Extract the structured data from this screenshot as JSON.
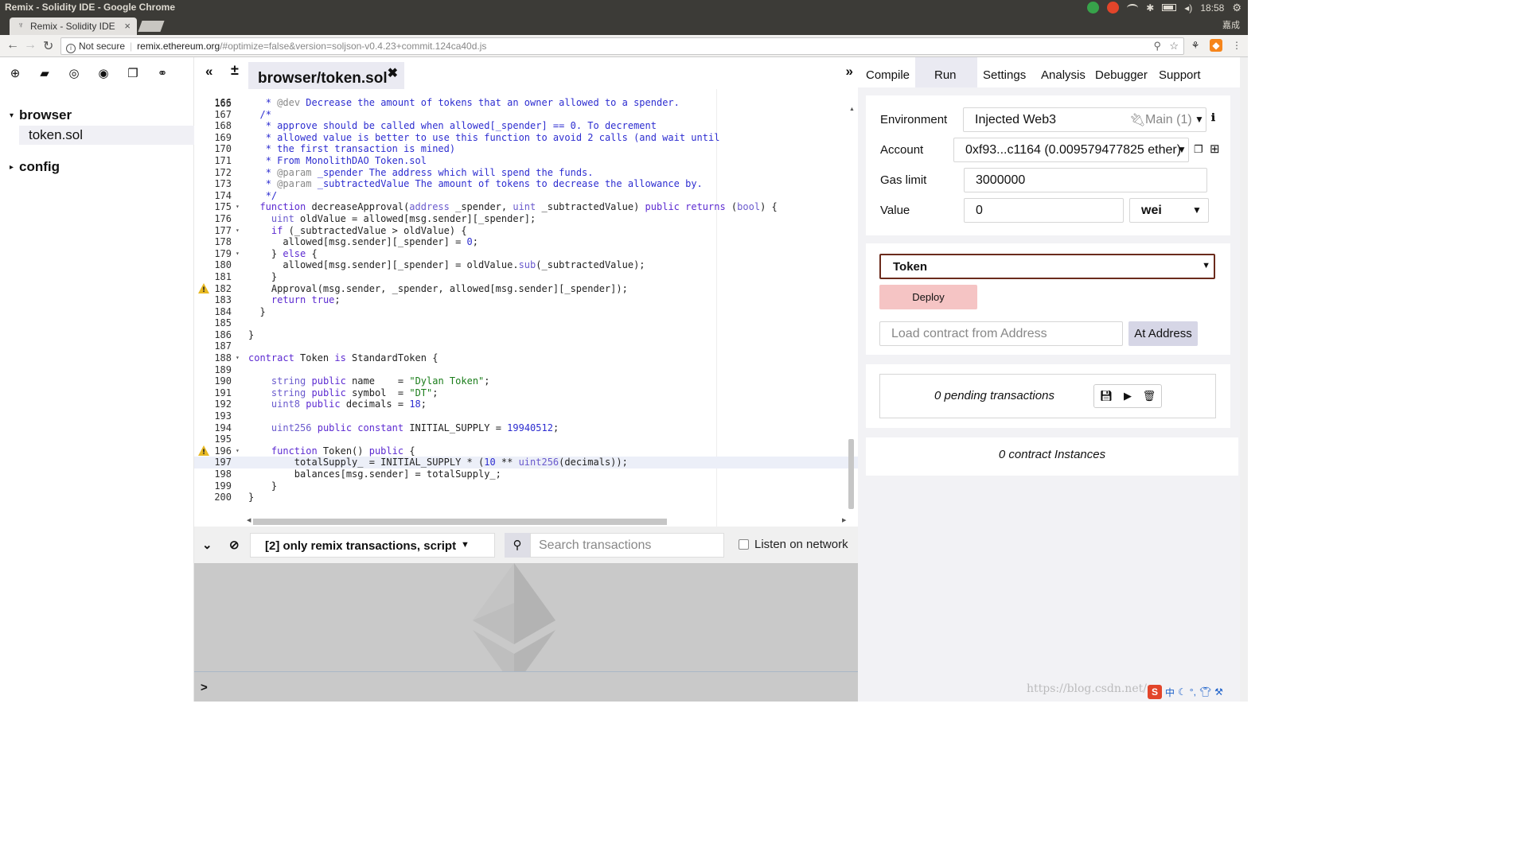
{
  "os": {
    "window_title": "Remix - Solidity IDE - Google Chrome",
    "clock": "18:58",
    "user": "嘉成"
  },
  "browser": {
    "tab_title": "Remix - Solidity IDE",
    "tab_close": "×",
    "security_label": "Not secure",
    "url_host": "remix.ethereum.org",
    "url_path": "/#optimize=false&version=soljson-v0.4.23+commit.124ca40d.js"
  },
  "files": {
    "tree": [
      {
        "label": "browser",
        "expanded": true,
        "caret": "▾"
      },
      {
        "label": "token.sol",
        "selected": true
      },
      {
        "label": "config",
        "expanded": false,
        "caret": "▸"
      }
    ]
  },
  "editor": {
    "collapse": "«",
    "add_file": "±",
    "tab_label": "browser/token.sol",
    "tab_close": "✖",
    "expand": "»",
    "first_partial_line": "165",
    "lines": [
      {
        "n": "166",
        "fold": "",
        "warn": false,
        "html": "   <span class='tok-cm'>* <span class='tok-tag'>@dev</span> Decrease the amount of tokens that an owner allowed to a spender.</span>"
      },
      {
        "n": "167",
        "fold": "",
        "warn": false,
        "html": "   <span class='tok-cm'>*</span>"
      },
      {
        "n": "168",
        "fold": "",
        "warn": false,
        "html": "   <span class='tok-cm'>* approve should be called when allowed[_spender] == 0. To decrement</span>"
      },
      {
        "n": "169",
        "fold": "",
        "warn": false,
        "html": "   <span class='tok-cm'>* allowed value is better to use this function to avoid 2 calls (and wait until</span>"
      },
      {
        "n": "170",
        "fold": "",
        "warn": false,
        "html": "   <span class='tok-cm'>* the first transaction is mined)</span>"
      },
      {
        "n": "171",
        "fold": "",
        "warn": false,
        "html": "   <span class='tok-cm'>* From MonolithDAO Token.sol</span>"
      },
      {
        "n": "172",
        "fold": "",
        "warn": false,
        "html": "   <span class='tok-cm'>* <span class='tok-tag'>@param</span> _spender The address which will spend the funds.</span>"
      },
      {
        "n": "173",
        "fold": "",
        "warn": false,
        "html": "   <span class='tok-cm'>* <span class='tok-tag'>@param</span> _subtractedValue The amount of tokens to decrease the allowance by.</span>"
      },
      {
        "n": "174",
        "fold": "",
        "warn": false,
        "html": "   <span class='tok-cm'>*/</span>"
      },
      {
        "n": "175",
        "fold": "▾",
        "warn": false,
        "html": "  <span class='tok-kw'>function</span> decreaseApproval(<span class='tok-ty'>address</span> _spender, <span class='tok-ty'>uint</span> _subtractedValue) <span class='tok-kw'>public returns</span> (<span class='tok-ty'>bool</span>) {"
      },
      {
        "n": "176",
        "fold": "",
        "warn": false,
        "html": "    <span class='tok-ty'>uint</span> oldValue = allowed[msg.sender][_spender];"
      },
      {
        "n": "177",
        "fold": "▾",
        "warn": false,
        "html": "    <span class='tok-kw'>if</span> (_subtractedValue &gt; oldValue) {"
      },
      {
        "n": "178",
        "fold": "",
        "warn": false,
        "html": "      allowed[msg.sender][_spender] = <span class='tok-num'>0</span>;"
      },
      {
        "n": "179",
        "fold": "▾",
        "warn": false,
        "html": "    } <span class='tok-kw'>else</span> {"
      },
      {
        "n": "180",
        "fold": "",
        "warn": false,
        "html": "      allowed[msg.sender][_spender] = oldValue.<span class='tok-ty'>sub</span>(_subtractedValue);"
      },
      {
        "n": "181",
        "fold": "",
        "warn": false,
        "html": "    }"
      },
      {
        "n": "182",
        "fold": "",
        "warn": true,
        "html": "    Approval(msg.sender, _spender, allowed[msg.sender][_spender]);"
      },
      {
        "n": "183",
        "fold": "",
        "warn": false,
        "html": "    <span class='tok-kw'>return</span> <span class='tok-kw'>true</span>;"
      },
      {
        "n": "184",
        "fold": "",
        "warn": false,
        "html": "  }"
      },
      {
        "n": "185",
        "fold": "",
        "warn": false,
        "html": ""
      },
      {
        "n": "186",
        "fold": "",
        "warn": false,
        "html": "}"
      },
      {
        "n": "187",
        "fold": "",
        "warn": false,
        "html": ""
      },
      {
        "n": "188",
        "fold": "▾",
        "warn": false,
        "html": "<span class='tok-kw'>contract</span> Token <span class='tok-kw'>is</span> StandardToken {"
      },
      {
        "n": "189",
        "fold": "",
        "warn": false,
        "html": ""
      },
      {
        "n": "190",
        "fold": "",
        "warn": false,
        "html": "    <span class='tok-ty'>string</span> <span class='tok-kw'>public</span> name    = <span class='tok-str'>\"Dylan Token\"</span>;"
      },
      {
        "n": "191",
        "fold": "",
        "warn": false,
        "html": "    <span class='tok-ty'>string</span> <span class='tok-kw'>public</span> symbol  = <span class='tok-str'>\"DT\"</span>;"
      },
      {
        "n": "192",
        "fold": "",
        "warn": false,
        "html": "    <span class='tok-ty'>uint8</span> <span class='tok-kw'>public</span> decimals = <span class='tok-num'>18</span>;"
      },
      {
        "n": "193",
        "fold": "",
        "warn": false,
        "html": ""
      },
      {
        "n": "194",
        "fold": "",
        "warn": false,
        "html": "    <span class='tok-ty'>uint256</span> <span class='tok-kw'>public constant</span> INITIAL_SUPPLY = <span class='tok-num'>19940512</span>;"
      },
      {
        "n": "195",
        "fold": "",
        "warn": false,
        "html": ""
      },
      {
        "n": "196",
        "fold": "▾",
        "warn": true,
        "html": "    <span class='tok-kw'>function</span> Token() <span class='tok-kw'>public</span> {"
      },
      {
        "n": "197",
        "fold": "",
        "warn": false,
        "active": true,
        "html": "        totalSupply_ = INITIAL_SUPPLY * (<span class='tok-num'>10</span> ** <span class='tok-ty'>uint256</span>(decimals));"
      },
      {
        "n": "198",
        "fold": "",
        "warn": false,
        "html": "        balances[msg.sender] = totalSupply_;"
      },
      {
        "n": "199",
        "fold": "",
        "warn": false,
        "html": "    }"
      },
      {
        "n": "200",
        "fold": "",
        "warn": false,
        "html": "}"
      }
    ]
  },
  "terminal": {
    "filter_label": "[2] only remix transactions, script",
    "search_placeholder": "Search transactions",
    "listen_label": "Listen on network",
    "prompt": ">"
  },
  "run": {
    "tabs": [
      "Compile",
      "Run",
      "Settings",
      "Analysis",
      "Debugger",
      "Support"
    ],
    "active_tab": "Run",
    "environment_label": "Environment",
    "environment_value": "Injected Web3",
    "network": "Main (1)",
    "account_label": "Account",
    "account_value": "0xf93...c1164 (0.009579477825 ether)",
    "gas_label": "Gas limit",
    "gas_value": "3000000",
    "value_label": "Value",
    "value_value": "0",
    "unit": "wei",
    "contract": "Token",
    "deploy_label": "Deploy",
    "load_placeholder": "Load contract from Address",
    "at_address_label": "At Address",
    "pending_text": "0 pending transactions",
    "instances_text": "0 contract Instances"
  },
  "watermark": "https://blog.csdn.net/..."
}
